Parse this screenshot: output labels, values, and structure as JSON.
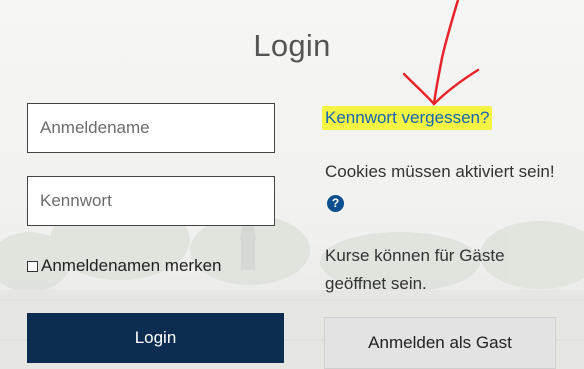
{
  "login": {
    "title": "Login",
    "username_placeholder": "Anmeldename",
    "password_placeholder": "Kennwort",
    "remember_label": "Anmeldenamen merken",
    "remember_checked": false,
    "login_button": "Login"
  },
  "info": {
    "forgot_link": "Kennwort vergessen?",
    "cookies_text": "Cookies müssen aktiviert sein!",
    "help_icon": "?",
    "guest_text": "Kurse können für Gäste geöffnet sein.",
    "guest_button": "Anmelden als Gast"
  },
  "colors": {
    "highlight": "#f3f542",
    "annotation_arrow": "#e8242b",
    "login_button_bg": "#0d2c52",
    "link": "#1864b5"
  }
}
